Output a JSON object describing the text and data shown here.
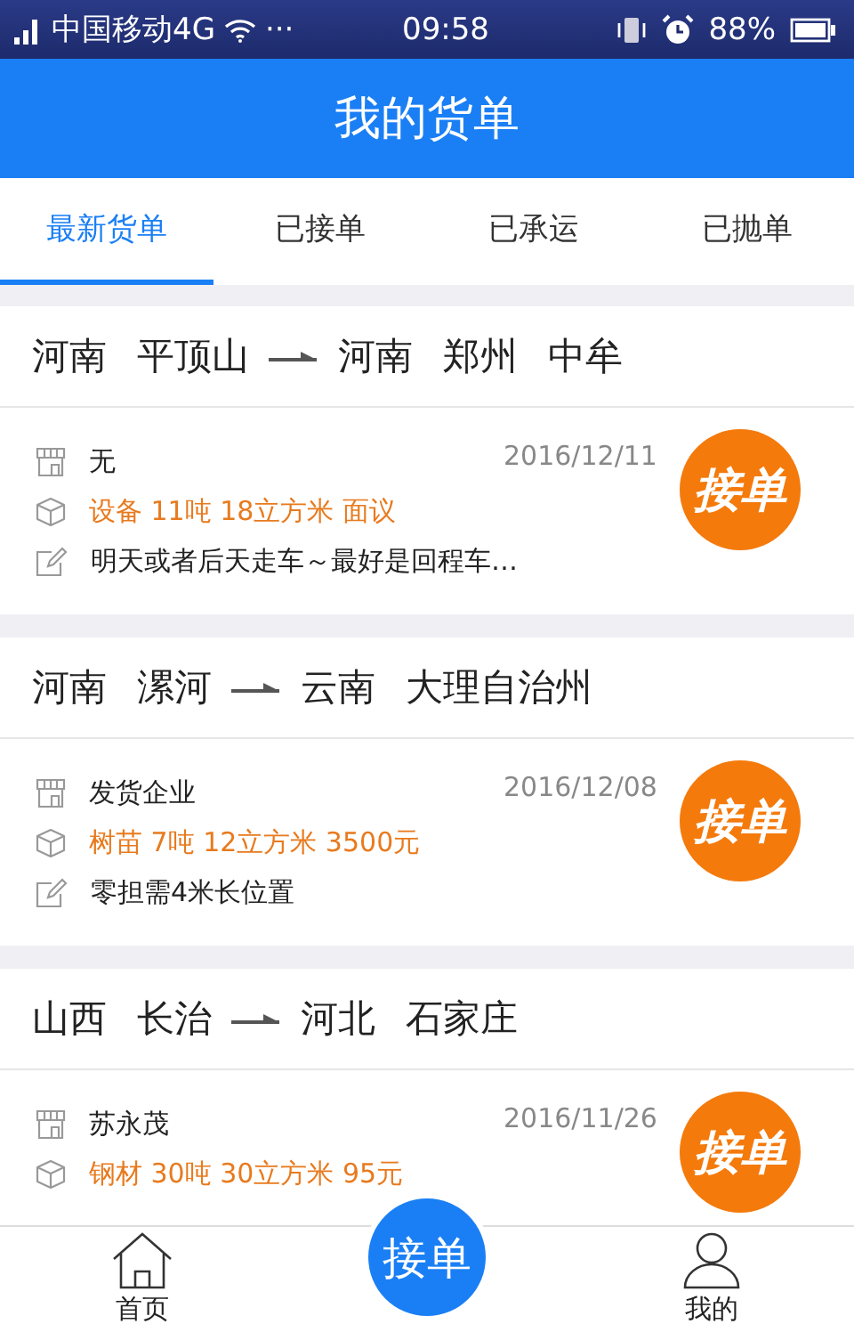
{
  "status_bar": {
    "carrier": "中国移动4G",
    "more": "···",
    "time": "09:58",
    "battery": "88%"
  },
  "header": {
    "title": "我的货单"
  },
  "tabs": [
    {
      "label": "最新货单",
      "selected": true
    },
    {
      "label": "已接单",
      "selected": false
    },
    {
      "label": "已承运",
      "selected": false
    },
    {
      "label": "已抛单",
      "selected": false
    }
  ],
  "orders": [
    {
      "from": [
        "河南",
        "平顶山"
      ],
      "to": [
        "河南",
        "郑州",
        "中牟"
      ],
      "shipper": "无",
      "date": "2016/12/11",
      "cargo": "设备  11吨  18立方米  面议",
      "note": "明天或者后天走车～最好是回程车…",
      "action": "接单"
    },
    {
      "from": [
        "河南",
        "漯河"
      ],
      "to": [
        "云南",
        "大理自治州"
      ],
      "shipper": "发货企业",
      "date": "2016/12/08",
      "cargo": "树苗  7吨  12立方米  3500元",
      "note": "零担需4米长位置",
      "action": "接单"
    },
    {
      "from": [
        "山西",
        "长治"
      ],
      "to": [
        "河北",
        "石家庄"
      ],
      "shipper": "苏永茂",
      "date": "2016/11/26",
      "cargo": "钢材  30吨  30立方米  95元",
      "action": "接单"
    }
  ],
  "bottom_nav": {
    "home": "首页",
    "center": "接单",
    "mine": "我的"
  }
}
